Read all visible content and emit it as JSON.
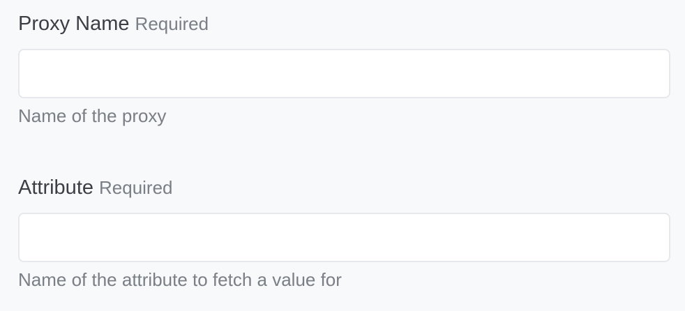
{
  "fields": [
    {
      "label": "Proxy Name",
      "required_label": "Required",
      "value": "",
      "placeholder": "",
      "help": "Name of the proxy"
    },
    {
      "label": "Attribute",
      "required_label": "Required",
      "value": "",
      "placeholder": "",
      "help": "Name of the attribute to fetch a value for"
    }
  ],
  "colors": {
    "background": "#f8f9fb",
    "input_border": "#e6e8eb",
    "label": "#3b3f45",
    "muted": "#7a7e85"
  }
}
